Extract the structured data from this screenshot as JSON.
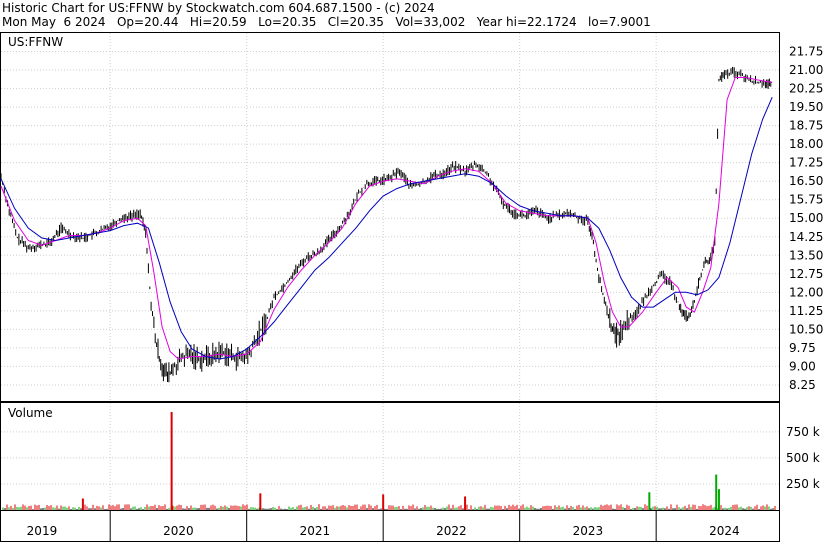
{
  "header": {
    "line1": "Historic Chart for US:FFNW by Stockwatch.com 604.687.1500 - (c) 2024",
    "line2": "Mon May  6 2024   Op=20.44   Hi=20.59   Lo=20.35   Cl=20.35   Vol=33,002   Year hi=22.1724   lo=7.9001"
  },
  "chart_data": [
    {
      "type": "line",
      "panel": "price",
      "symbol_label": "US:FFNW",
      "title": "",
      "xlabel": "",
      "ylabel": "",
      "y_ticks": [
        "21.75",
        "21.00",
        "20.25",
        "19.50",
        "18.75",
        "18.00",
        "17.25",
        "16.50",
        "15.75",
        "15.00",
        "14.25",
        "13.50",
        "12.75",
        "12.00",
        "11.25",
        "10.50",
        "9.75",
        "9.00",
        "8.25"
      ],
      "ylim": [
        7.6,
        22.5
      ],
      "x_ticks": [
        "2019",
        "2020",
        "2021",
        "2022",
        "2023",
        "2024"
      ],
      "xlim": [
        2018.7,
        2024.4
      ],
      "grid": true,
      "colors": {
        "price": "#000000",
        "ma_short": "#e000e0",
        "ma_long": "#0000c0"
      },
      "series": [
        {
          "role": "price",
          "points": [
            [
              2018.7,
              16.7
            ],
            [
              2018.76,
              15.3
            ],
            [
              2018.82,
              14.2
            ],
            [
              2018.9,
              13.8
            ],
            [
              2018.98,
              13.9
            ],
            [
              2019.06,
              14.0
            ],
            [
              2019.14,
              14.6
            ],
            [
              2019.22,
              14.3
            ],
            [
              2019.3,
              14.2
            ],
            [
              2019.4,
              14.4
            ],
            [
              2019.5,
              14.7
            ],
            [
              2019.58,
              15.0
            ],
            [
              2019.66,
              15.1
            ],
            [
              2019.72,
              15.2
            ],
            [
              2019.76,
              14.4
            ],
            [
              2019.8,
              11.5
            ],
            [
              2019.84,
              9.8
            ],
            [
              2019.88,
              9.0
            ],
            [
              2019.92,
              8.6
            ],
            [
              2019.96,
              8.9
            ],
            [
              2020.02,
              9.3
            ],
            [
              2020.08,
              9.5
            ],
            [
              2020.16,
              9.3
            ],
            [
              2020.24,
              9.4
            ],
            [
              2020.32,
              9.6
            ],
            [
              2020.4,
              9.4
            ],
            [
              2020.46,
              9.3
            ],
            [
              2020.52,
              9.5
            ],
            [
              2020.58,
              10.2
            ],
            [
              2020.64,
              10.8
            ],
            [
              2020.7,
              11.8
            ],
            [
              2020.78,
              12.3
            ],
            [
              2020.86,
              12.9
            ],
            [
              2020.94,
              13.4
            ],
            [
              2021.02,
              13.6
            ],
            [
              2021.1,
              14.1
            ],
            [
              2021.18,
              14.6
            ],
            [
              2021.26,
              15.3
            ],
            [
              2021.32,
              16.0
            ],
            [
              2021.38,
              16.4
            ],
            [
              2021.46,
              16.5
            ],
            [
              2021.54,
              16.6
            ],
            [
              2021.62,
              16.9
            ],
            [
              2021.7,
              16.3
            ],
            [
              2021.78,
              16.4
            ],
            [
              2021.86,
              16.7
            ],
            [
              2021.94,
              16.8
            ],
            [
              2022.02,
              17.1
            ],
            [
              2022.1,
              16.9
            ],
            [
              2022.18,
              17.2
            ],
            [
              2022.26,
              16.8
            ],
            [
              2022.32,
              16.2
            ],
            [
              2022.38,
              15.6
            ],
            [
              2022.46,
              15.2
            ],
            [
              2022.54,
              15.1
            ],
            [
              2022.62,
              15.3
            ],
            [
              2022.7,
              15.0
            ],
            [
              2022.78,
              15.1
            ],
            [
              2022.86,
              15.2
            ],
            [
              2022.94,
              15.0
            ],
            [
              2023.0,
              14.9
            ],
            [
              2023.04,
              14.0
            ],
            [
              2023.08,
              12.6
            ],
            [
              2023.12,
              11.7
            ],
            [
              2023.16,
              10.9
            ],
            [
              2023.2,
              10.2
            ],
            [
              2023.24,
              10.4
            ],
            [
              2023.3,
              10.9
            ],
            [
              2023.36,
              11.2
            ],
            [
              2023.42,
              11.8
            ],
            [
              2023.48,
              12.3
            ],
            [
              2023.54,
              12.7
            ],
            [
              2023.6,
              12.4
            ],
            [
              2023.66,
              11.6
            ],
            [
              2023.7,
              11.1
            ],
            [
              2023.74,
              11.0
            ],
            [
              2023.78,
              11.6
            ],
            [
              2023.82,
              12.6
            ],
            [
              2023.86,
              13.2
            ],
            [
              2023.9,
              13.4
            ],
            [
              2023.93,
              14.0
            ],
            [
              2023.96,
              20.6
            ],
            [
              2024.0,
              20.8
            ],
            [
              2024.06,
              20.9
            ],
            [
              2024.12,
              20.8
            ],
            [
              2024.18,
              20.6
            ],
            [
              2024.24,
              20.5
            ],
            [
              2024.3,
              20.5
            ],
            [
              2024.35,
              20.35
            ]
          ]
        },
        {
          "role": "ma_short",
          "points": [
            [
              2018.7,
              16.3
            ],
            [
              2018.8,
              14.9
            ],
            [
              2018.9,
              14.1
            ],
            [
              2019.0,
              13.9
            ],
            [
              2019.1,
              14.1
            ],
            [
              2019.2,
              14.3
            ],
            [
              2019.3,
              14.3
            ],
            [
              2019.4,
              14.4
            ],
            [
              2019.5,
              14.6
            ],
            [
              2019.6,
              14.9
            ],
            [
              2019.7,
              15.0
            ],
            [
              2019.76,
              14.7
            ],
            [
              2019.82,
              12.8
            ],
            [
              2019.88,
              10.6
            ],
            [
              2019.94,
              9.6
            ],
            [
              2020.0,
              9.3
            ],
            [
              2020.1,
              9.4
            ],
            [
              2020.2,
              9.4
            ],
            [
              2020.3,
              9.5
            ],
            [
              2020.4,
              9.4
            ],
            [
              2020.5,
              9.5
            ],
            [
              2020.6,
              10.0
            ],
            [
              2020.7,
              11.3
            ],
            [
              2020.8,
              12.2
            ],
            [
              2020.9,
              12.9
            ],
            [
              2021.0,
              13.5
            ],
            [
              2021.1,
              14.0
            ],
            [
              2021.2,
              14.6
            ],
            [
              2021.3,
              15.6
            ],
            [
              2021.4,
              16.3
            ],
            [
              2021.5,
              16.5
            ],
            [
              2021.6,
              16.6
            ],
            [
              2021.7,
              16.5
            ],
            [
              2021.8,
              16.4
            ],
            [
              2021.9,
              16.7
            ],
            [
              2022.0,
              16.9
            ],
            [
              2022.1,
              17.0
            ],
            [
              2022.2,
              16.9
            ],
            [
              2022.3,
              16.4
            ],
            [
              2022.4,
              15.6
            ],
            [
              2022.5,
              15.3
            ],
            [
              2022.6,
              15.2
            ],
            [
              2022.7,
              15.1
            ],
            [
              2022.8,
              15.1
            ],
            [
              2022.9,
              15.1
            ],
            [
              2023.0,
              15.0
            ],
            [
              2023.06,
              14.0
            ],
            [
              2023.12,
              12.4
            ],
            [
              2023.18,
              11.2
            ],
            [
              2023.24,
              10.6
            ],
            [
              2023.3,
              10.6
            ],
            [
              2023.4,
              11.2
            ],
            [
              2023.5,
              12.0
            ],
            [
              2023.58,
              12.6
            ],
            [
              2023.66,
              12.2
            ],
            [
              2023.72,
              11.4
            ],
            [
              2023.78,
              11.2
            ],
            [
              2023.84,
              12.0
            ],
            [
              2023.9,
              13.0
            ],
            [
              2023.96,
              15.6
            ],
            [
              2024.02,
              19.8
            ],
            [
              2024.08,
              20.7
            ],
            [
              2024.16,
              20.7
            ],
            [
              2024.24,
              20.6
            ],
            [
              2024.35,
              20.5
            ]
          ]
        },
        {
          "role": "ma_long",
          "points": [
            [
              2018.7,
              16.6
            ],
            [
              2018.8,
              15.4
            ],
            [
              2018.9,
              14.6
            ],
            [
              2019.0,
              14.2
            ],
            [
              2019.1,
              14.1
            ],
            [
              2019.2,
              14.2
            ],
            [
              2019.3,
              14.3
            ],
            [
              2019.4,
              14.4
            ],
            [
              2019.5,
              14.5
            ],
            [
              2019.6,
              14.7
            ],
            [
              2019.7,
              14.8
            ],
            [
              2019.78,
              14.6
            ],
            [
              2019.86,
              13.2
            ],
            [
              2019.94,
              11.6
            ],
            [
              2020.02,
              10.4
            ],
            [
              2020.1,
              9.7
            ],
            [
              2020.2,
              9.4
            ],
            [
              2020.3,
              9.3
            ],
            [
              2020.4,
              9.4
            ],
            [
              2020.5,
              9.7
            ],
            [
              2020.6,
              10.2
            ],
            [
              2020.7,
              10.8
            ],
            [
              2020.8,
              11.5
            ],
            [
              2020.9,
              12.2
            ],
            [
              2021.0,
              12.9
            ],
            [
              2021.1,
              13.4
            ],
            [
              2021.2,
              14.0
            ],
            [
              2021.3,
              14.6
            ],
            [
              2021.4,
              15.3
            ],
            [
              2021.5,
              15.9
            ],
            [
              2021.6,
              16.2
            ],
            [
              2021.7,
              16.4
            ],
            [
              2021.8,
              16.5
            ],
            [
              2021.9,
              16.6
            ],
            [
              2022.0,
              16.7
            ],
            [
              2022.1,
              16.8
            ],
            [
              2022.2,
              16.7
            ],
            [
              2022.3,
              16.4
            ],
            [
              2022.4,
              15.9
            ],
            [
              2022.5,
              15.5
            ],
            [
              2022.6,
              15.3
            ],
            [
              2022.7,
              15.2
            ],
            [
              2022.8,
              15.1
            ],
            [
              2022.9,
              15.1
            ],
            [
              2023.0,
              15.0
            ],
            [
              2023.08,
              14.6
            ],
            [
              2023.16,
              13.7
            ],
            [
              2023.24,
              12.6
            ],
            [
              2023.32,
              11.8
            ],
            [
              2023.4,
              11.4
            ],
            [
              2023.48,
              11.4
            ],
            [
              2023.56,
              11.7
            ],
            [
              2023.64,
              12.0
            ],
            [
              2023.72,
              12.0
            ],
            [
              2023.8,
              11.9
            ],
            [
              2023.88,
              12.1
            ],
            [
              2023.96,
              12.6
            ],
            [
              2024.04,
              14.0
            ],
            [
              2024.12,
              15.8
            ],
            [
              2024.2,
              17.6
            ],
            [
              2024.28,
              19.0
            ],
            [
              2024.35,
              19.9
            ]
          ]
        }
      ]
    },
    {
      "type": "bar",
      "panel": "volume",
      "title": "Volume",
      "y_ticks": [
        "750 k",
        "500 k",
        "250 k"
      ],
      "ylim": [
        0,
        950000
      ],
      "colors": {
        "up": "#00aa00",
        "down": "#dd0000",
        "neutral": "#000000"
      },
      "spikes": [
        {
          "x": 2019.95,
          "value": 940000,
          "direction": "down"
        },
        {
          "x": 2023.94,
          "value": 340000,
          "direction": "up"
        },
        {
          "x": 2023.45,
          "value": 170000,
          "direction": "up"
        },
        {
          "x": 2020.6,
          "value": 160000,
          "direction": "down"
        },
        {
          "x": 2021.5,
          "value": 150000,
          "direction": "down"
        },
        {
          "x": 2022.1,
          "value": 130000,
          "direction": "down"
        },
        {
          "x": 2019.3,
          "value": 110000,
          "direction": "down"
        },
        {
          "x": 2023.96,
          "value": 200000,
          "direction": "up"
        }
      ],
      "baseline_volume": 40000
    }
  ]
}
